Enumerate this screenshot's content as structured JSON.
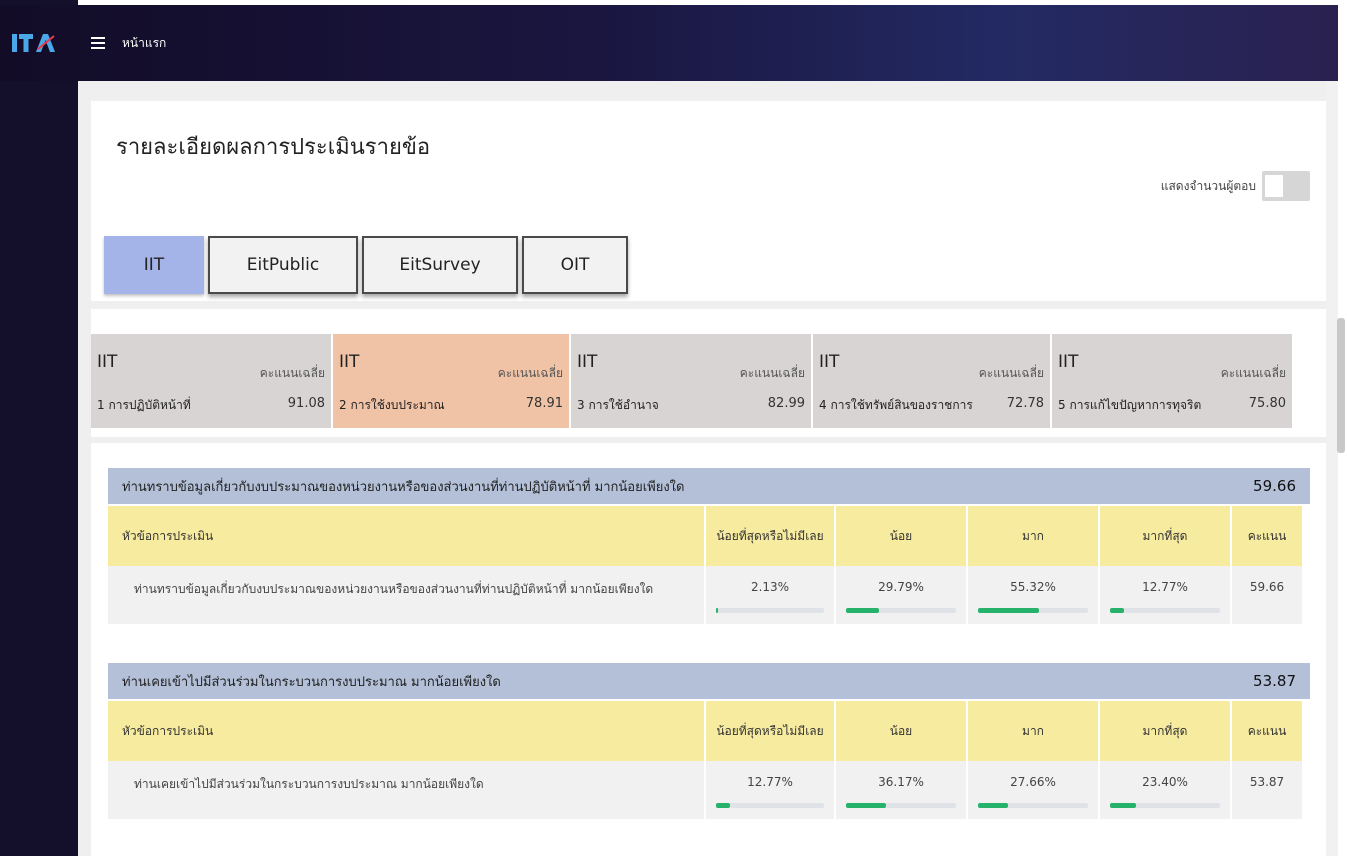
{
  "header": {
    "logo_text": "ITA",
    "menu_icon": "hamburger-icon",
    "home_label": "หน้าแรก"
  },
  "page": {
    "title": "รายละเอียดผลการประเมินรายข้อ",
    "toggle_label": "แสดงจำนวนผู้ตอบ",
    "toggle_on": false
  },
  "tabs": [
    {
      "label": "IIT",
      "active": true
    },
    {
      "label": "EitPublic",
      "active": false
    },
    {
      "label": "EitSurvey",
      "active": false
    },
    {
      "label": "OIT",
      "active": false
    }
  ],
  "score_cards": [
    {
      "title": "IIT",
      "avg_label": "คะแนนเฉลี่ย",
      "name": "1 การปฏิบัติหน้าที่",
      "score": "91.08",
      "selected": false
    },
    {
      "title": "IIT",
      "avg_label": "คะแนนเฉลี่ย",
      "name": "2 การใช้งบประมาณ",
      "score": "78.91",
      "selected": true
    },
    {
      "title": "IIT",
      "avg_label": "คะแนนเฉลี่ย",
      "name": "3 การใช้อำนาจ",
      "score": "82.99",
      "selected": false
    },
    {
      "title": "IIT",
      "avg_label": "คะแนนเฉลี่ย",
      "name": "4 การใช้ทรัพย์สินของราชการ",
      "score": "72.78",
      "selected": false
    },
    {
      "title": "IIT",
      "avg_label": "คะแนนเฉลี่ย",
      "name": "5 การแก้ไขปัญหาการทุจริต",
      "score": "75.80",
      "selected": false
    }
  ],
  "table_headers": {
    "topic": "หัวข้อการประเมิน",
    "least": "น้อยที่สุดหรือไม่มีเลย",
    "little": "น้อย",
    "much": "มาก",
    "most": "มากที่สุด",
    "score": "คะแนน"
  },
  "questions": [
    {
      "title": "ท่านทราบข้อมูลเกี่ยวกับงบประมาณของหน่วยงานหรือของส่วนงานที่ท่านปฏิบัติหน้าที่ มากน้อยเพียงใด",
      "score": "59.66",
      "row_text": "ท่านทราบข้อมูลเกี่ยวกับงบประมาณของหน่วยงานหรือของส่วนงานที่ท่านปฏิบัติหน้าที่ มากน้อยเพียงใด",
      "least": "2.13%",
      "little": "29.79%",
      "much": "55.32%",
      "most": "12.77%",
      "least_pct": 2.13,
      "little_pct": 29.79,
      "much_pct": 55.32,
      "most_pct": 12.77,
      "row_score": "59.66"
    },
    {
      "title": "ท่านเคยเข้าไปมีส่วนร่วมในกระบวนการงบประมาณ มากน้อยเพียงใด",
      "score": "53.87",
      "row_text": "ท่านเคยเข้าไปมีส่วนร่วมในกระบวนการงบประมาณ มากน้อยเพียงใด",
      "least": "12.77%",
      "little": "36.17%",
      "much": "27.66%",
      "most": "23.40%",
      "least_pct": 12.77,
      "little_pct": 36.17,
      "much_pct": 27.66,
      "most_pct": 23.4,
      "row_score": "53.87"
    }
  ],
  "colors": {
    "tab_active": "#a4b4e8",
    "card_selected": "#f0c3a7",
    "question_header": "#b3c0d8",
    "table_header": "#f7eba0",
    "bar": "#26b26b"
  }
}
